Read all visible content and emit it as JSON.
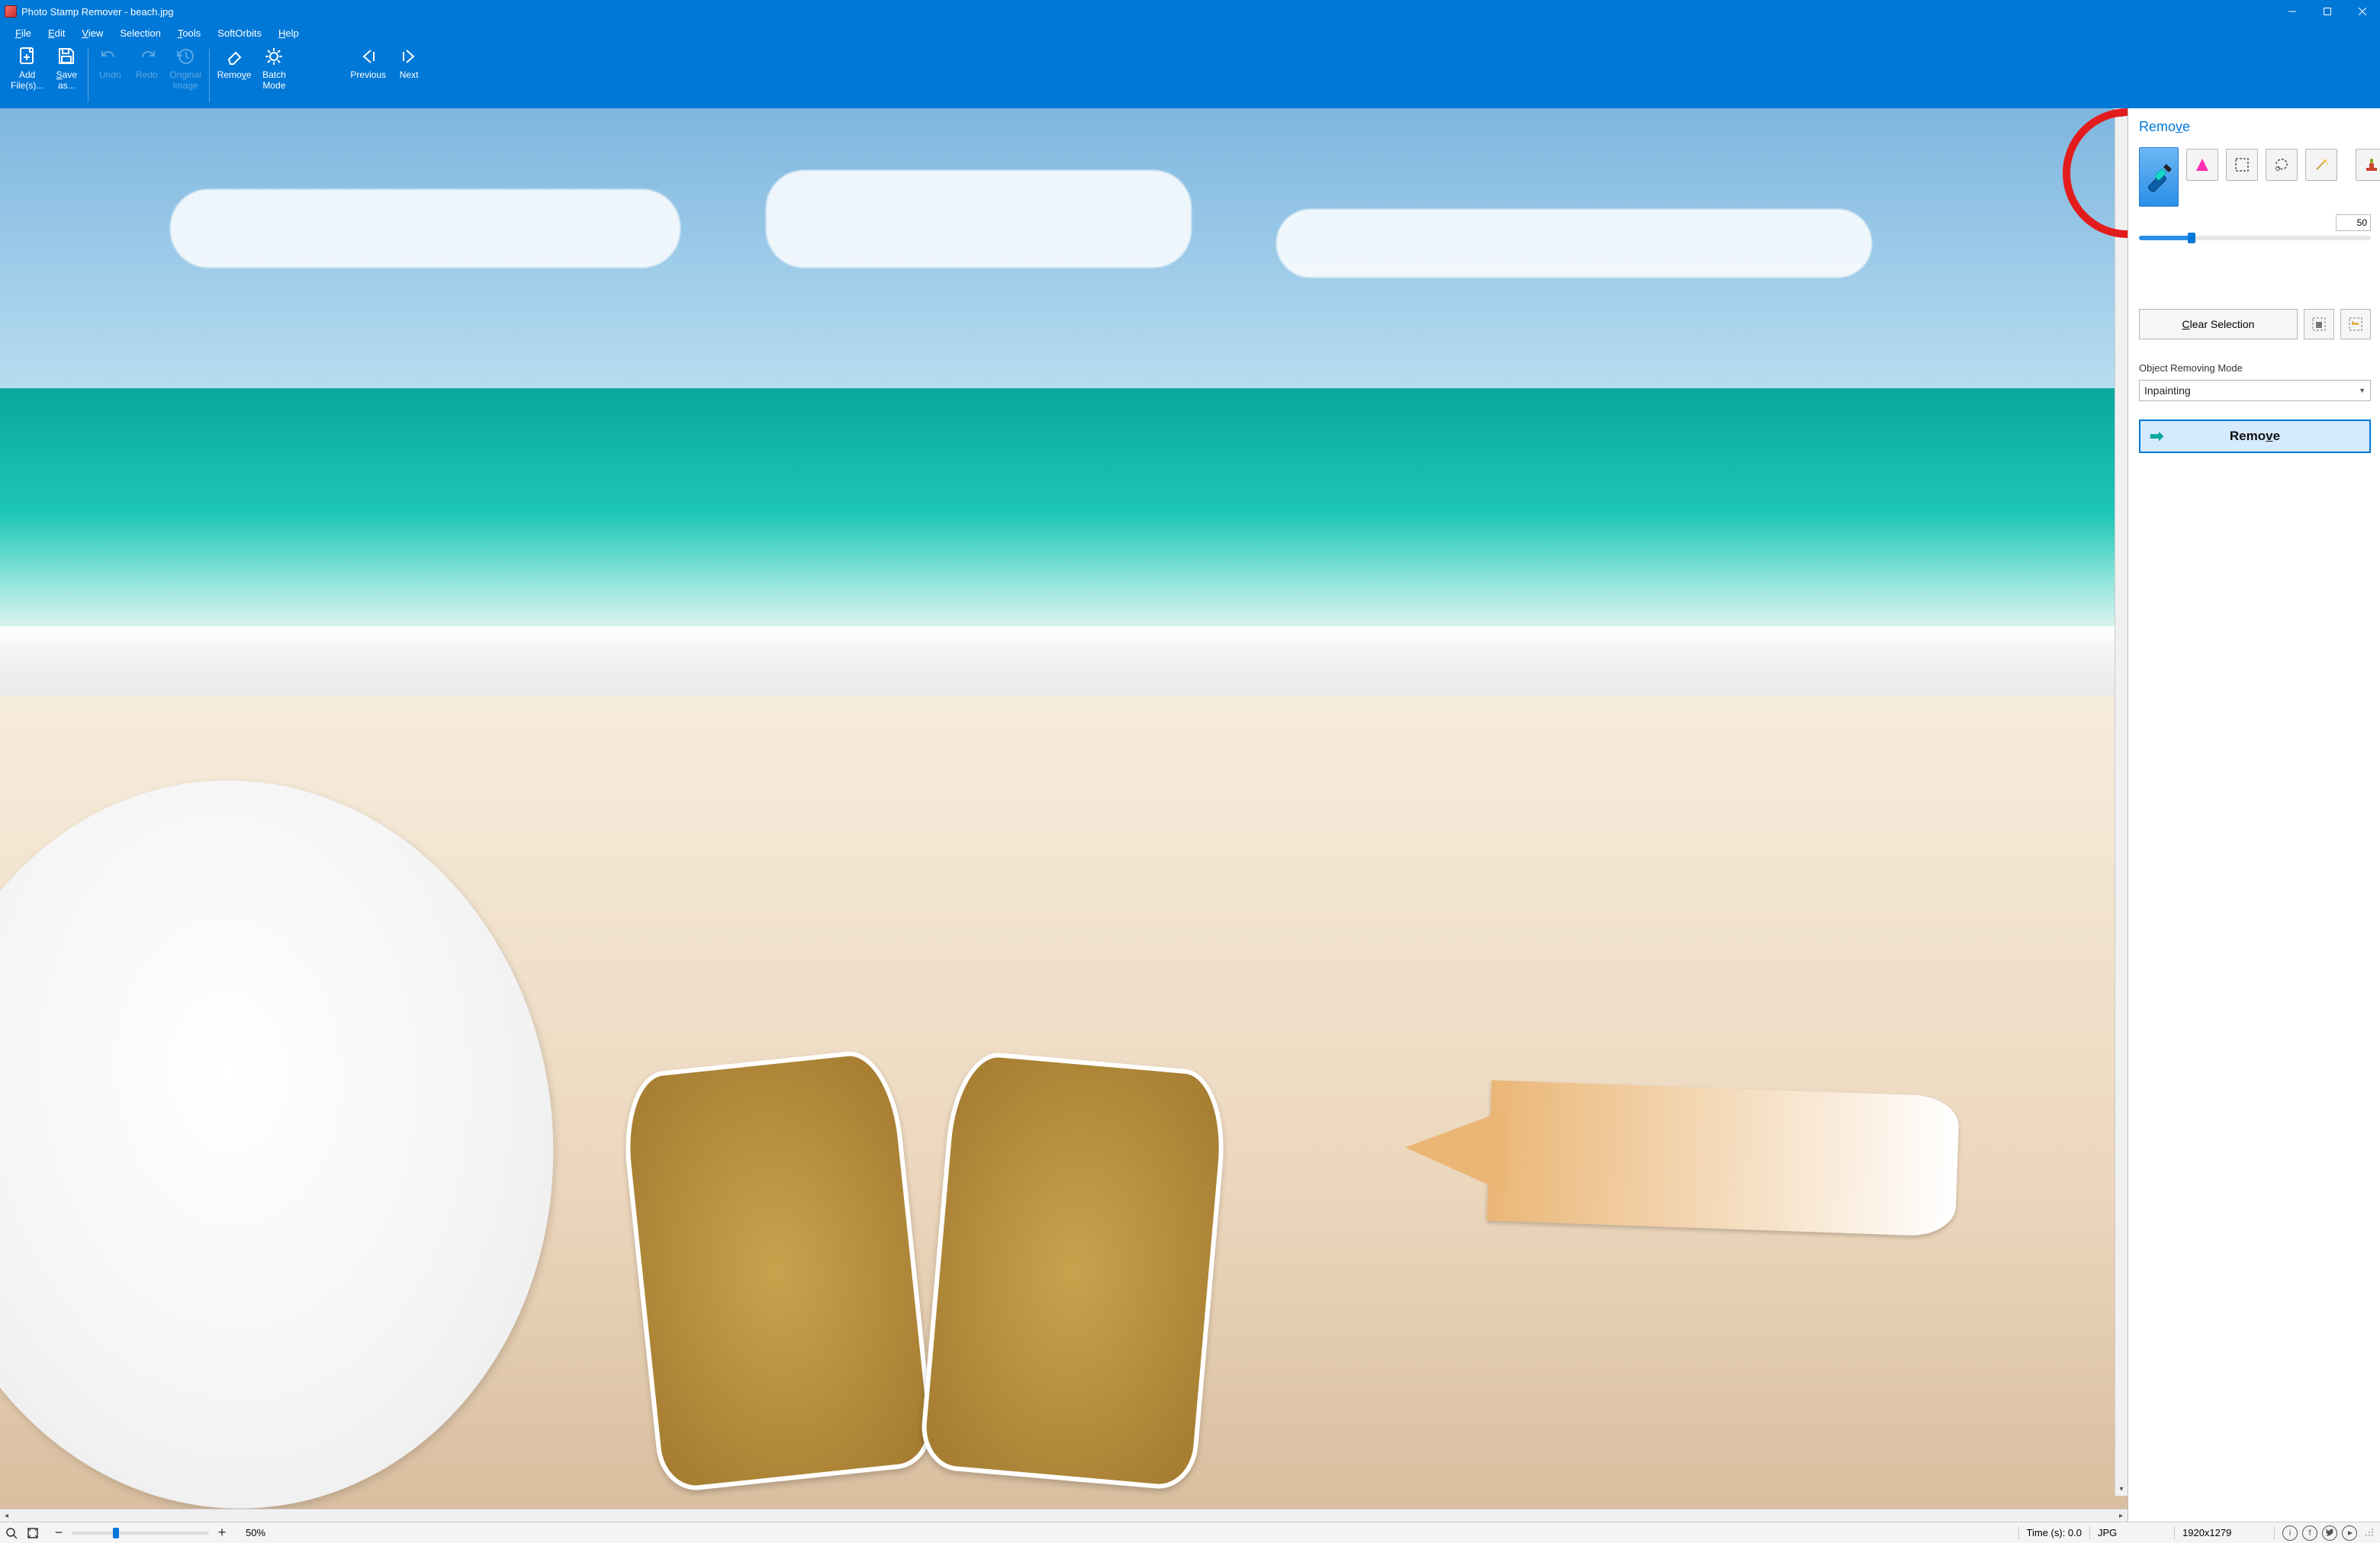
{
  "window": {
    "title": "Photo Stamp Remover - beach.jpg"
  },
  "menu": {
    "file": "File",
    "edit": "Edit",
    "view": "View",
    "selection": "Selection",
    "tools": "Tools",
    "softorbits": "SoftOrbits",
    "help": "Help"
  },
  "ribbon": {
    "add_files": "Add\nFile(s)...",
    "save_as": "Save\nas...",
    "undo": "Undo",
    "redo": "Redo",
    "original": "Original\nImage",
    "remove": "Remove",
    "batch": "Batch\nMode",
    "previous": "Previous",
    "next": "Next"
  },
  "panel": {
    "title": "Remove",
    "brush_size": "50",
    "clear_selection": "Clear Selection",
    "mode_label": "Object Removing Mode",
    "mode_value": "Inpainting",
    "remove_button": "Remove"
  },
  "tools": {
    "marker": "marker-tool",
    "color": "color-select-tool",
    "rect": "rectangle-select-tool",
    "lasso": "freeform-select-tool",
    "wand": "magic-wand-tool",
    "stamp": "clone-stamp-tool"
  },
  "status": {
    "zoom": "50%",
    "time": "Time (s): 0.0",
    "format": "JPG",
    "dimensions": "1920x1279"
  }
}
